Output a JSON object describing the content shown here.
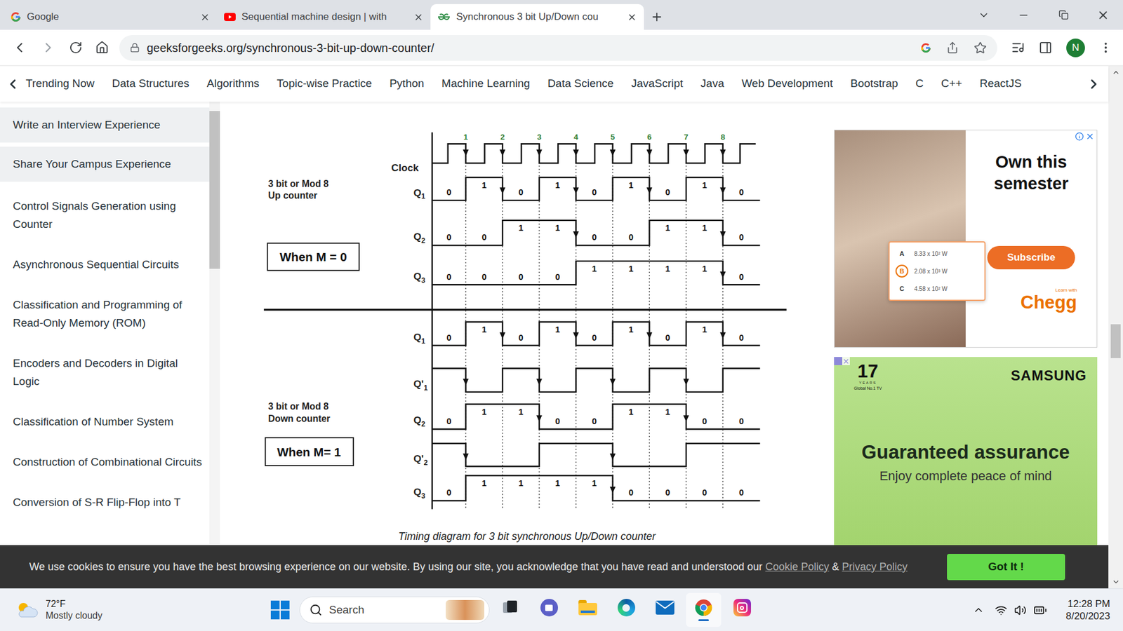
{
  "browser": {
    "tabs": [
      {
        "label": "Google",
        "selected": false,
        "kind": "google"
      },
      {
        "label": "Sequential machine design | with",
        "selected": false,
        "kind": "youtube"
      },
      {
        "label": "Synchronous 3 bit Up/Down cou",
        "selected": true,
        "kind": "gfg"
      }
    ],
    "address": "geeksforgeeks.org/synchronous-3-bit-up-down-counter/",
    "profile": "N"
  },
  "nav": {
    "items": [
      "Trending Now",
      "Data Structures",
      "Algorithms",
      "Topic-wise Practice",
      "Python",
      "Machine Learning",
      "Data Science",
      "JavaScript",
      "Java",
      "Web Development",
      "Bootstrap",
      "C",
      "C++",
      "ReactJS"
    ]
  },
  "sidebar": {
    "items": [
      {
        "label": "Write an Interview Experience",
        "kind": "action"
      },
      {
        "label": "Share Your Campus Experience",
        "kind": "action"
      },
      {
        "label": "Control Signals Generation using Counter",
        "kind": "link"
      },
      {
        "label": "Asynchronous Sequential Circuits",
        "kind": "link"
      },
      {
        "label": "Classification and Programming of Read-Only Memory (ROM)",
        "kind": "link"
      },
      {
        "label": "Encoders and Decoders in Digital Logic",
        "kind": "link"
      },
      {
        "label": "Classification of Number System",
        "kind": "link"
      },
      {
        "label": "Construction of Combinational Circuits",
        "kind": "link"
      },
      {
        "label": "Conversion of S-R Flip-Flop into T",
        "kind": "link"
      }
    ]
  },
  "diagram": {
    "clock": {
      "name": "Clock",
      "numbers": [
        "1",
        "2",
        "3",
        "4",
        "5",
        "6",
        "7",
        "8"
      ]
    },
    "up": {
      "title_lines": [
        "3 bit or Mod 8",
        "Up counter"
      ],
      "mode": "When M = 0",
      "signals": [
        {
          "name": "Q",
          "sub": "1",
          "levels": [
            0,
            1,
            0,
            1,
            0,
            1,
            0,
            1,
            0
          ],
          "bits": [
            "0",
            "1",
            "0",
            "1",
            "0",
            "1",
            "0",
            "1",
            "0"
          ]
        },
        {
          "name": "Q",
          "sub": "2",
          "levels": [
            0,
            0,
            1,
            1,
            0,
            0,
            1,
            1,
            0
          ],
          "bits": [
            "0",
            "0",
            "1",
            "1",
            "0",
            "0",
            "1",
            "1",
            "0"
          ]
        },
        {
          "name": "Q",
          "sub": "3",
          "levels": [
            0,
            0,
            0,
            0,
            1,
            1,
            1,
            1,
            0
          ],
          "bits": [
            "0",
            "0",
            "0",
            "0",
            "1",
            "1",
            "1",
            "1",
            "0"
          ]
        }
      ]
    },
    "down": {
      "title_lines": [
        "3 bit or Mod 8",
        "Down counter"
      ],
      "mode": "When M= 1",
      "signals": [
        {
          "name": "Q",
          "sub": "1",
          "levels": [
            0,
            1,
            0,
            1,
            0,
            1,
            0,
            1,
            0
          ],
          "bits": [
            "0",
            "1",
            "0",
            "1",
            "0",
            "1",
            "0",
            "1",
            "0"
          ]
        },
        {
          "name": "Q'",
          "sub": "1",
          "levels": [
            1,
            0,
            1,
            0,
            1,
            0,
            1,
            0,
            1
          ],
          "bits": []
        },
        {
          "name": "Q",
          "sub": "2",
          "levels": [
            0,
            1,
            1,
            0,
            0,
            1,
            1,
            0,
            0
          ],
          "bits": [
            "0",
            "1",
            "1",
            "0",
            "0",
            "1",
            "1",
            "0",
            "0"
          ]
        },
        {
          "name": "Q'",
          "sub": "2",
          "levels": [
            1,
            0,
            0,
            1,
            1,
            0,
            0,
            1,
            1
          ],
          "bits": []
        },
        {
          "name": "Q",
          "sub": "3",
          "levels": [
            0,
            1,
            1,
            1,
            1,
            0,
            0,
            0,
            0
          ],
          "bits": [
            "0",
            "1",
            "1",
            "1",
            "1",
            "0",
            "0",
            "0",
            "0"
          ]
        }
      ]
    },
    "caption": "Timing diagram for 3 bit synchronous Up/Down counter"
  },
  "ads": {
    "chegg": {
      "headline": "Own this semester",
      "options": [
        {
          "letter": "A",
          "text": "8.33 x 10² W",
          "selected": false
        },
        {
          "letter": "B",
          "text": "2.08 x 10³ W",
          "selected": true
        },
        {
          "letter": "C",
          "text": "4.58 x 10² W",
          "selected": false
        }
      ],
      "button": "Subscribe",
      "brand_tag": "Learn with",
      "brand": "Chegg"
    },
    "samsung": {
      "badge": "17",
      "badge_sub": "YEARS",
      "badge_caption": "Global No.1 TV",
      "brand": "SAMSUNG",
      "headline": "Guaranteed assurance",
      "subline": "Enjoy complete peace of mind"
    }
  },
  "cookie_banner": {
    "text": "We use cookies to ensure you have the best browsing experience on our website. By using our site, you acknowledge that you have read and understood our ",
    "links": [
      "Cookie Policy",
      "Privacy Policy"
    ],
    "joiner": " & ",
    "button": "Got It !"
  },
  "taskbar": {
    "weather": {
      "temp": "72°F",
      "condition": "Mostly cloudy"
    },
    "search": "Search",
    "apps": [
      {
        "kind": "taskview",
        "active": false
      },
      {
        "kind": "teams",
        "active": false
      },
      {
        "kind": "explorer",
        "active": false
      },
      {
        "kind": "edge",
        "active": false
      },
      {
        "kind": "mail",
        "active": false
      },
      {
        "kind": "chrome",
        "active": true
      },
      {
        "kind": "instagram",
        "active": false
      }
    ],
    "time": "12:28 PM",
    "date": "8/20/2023"
  }
}
